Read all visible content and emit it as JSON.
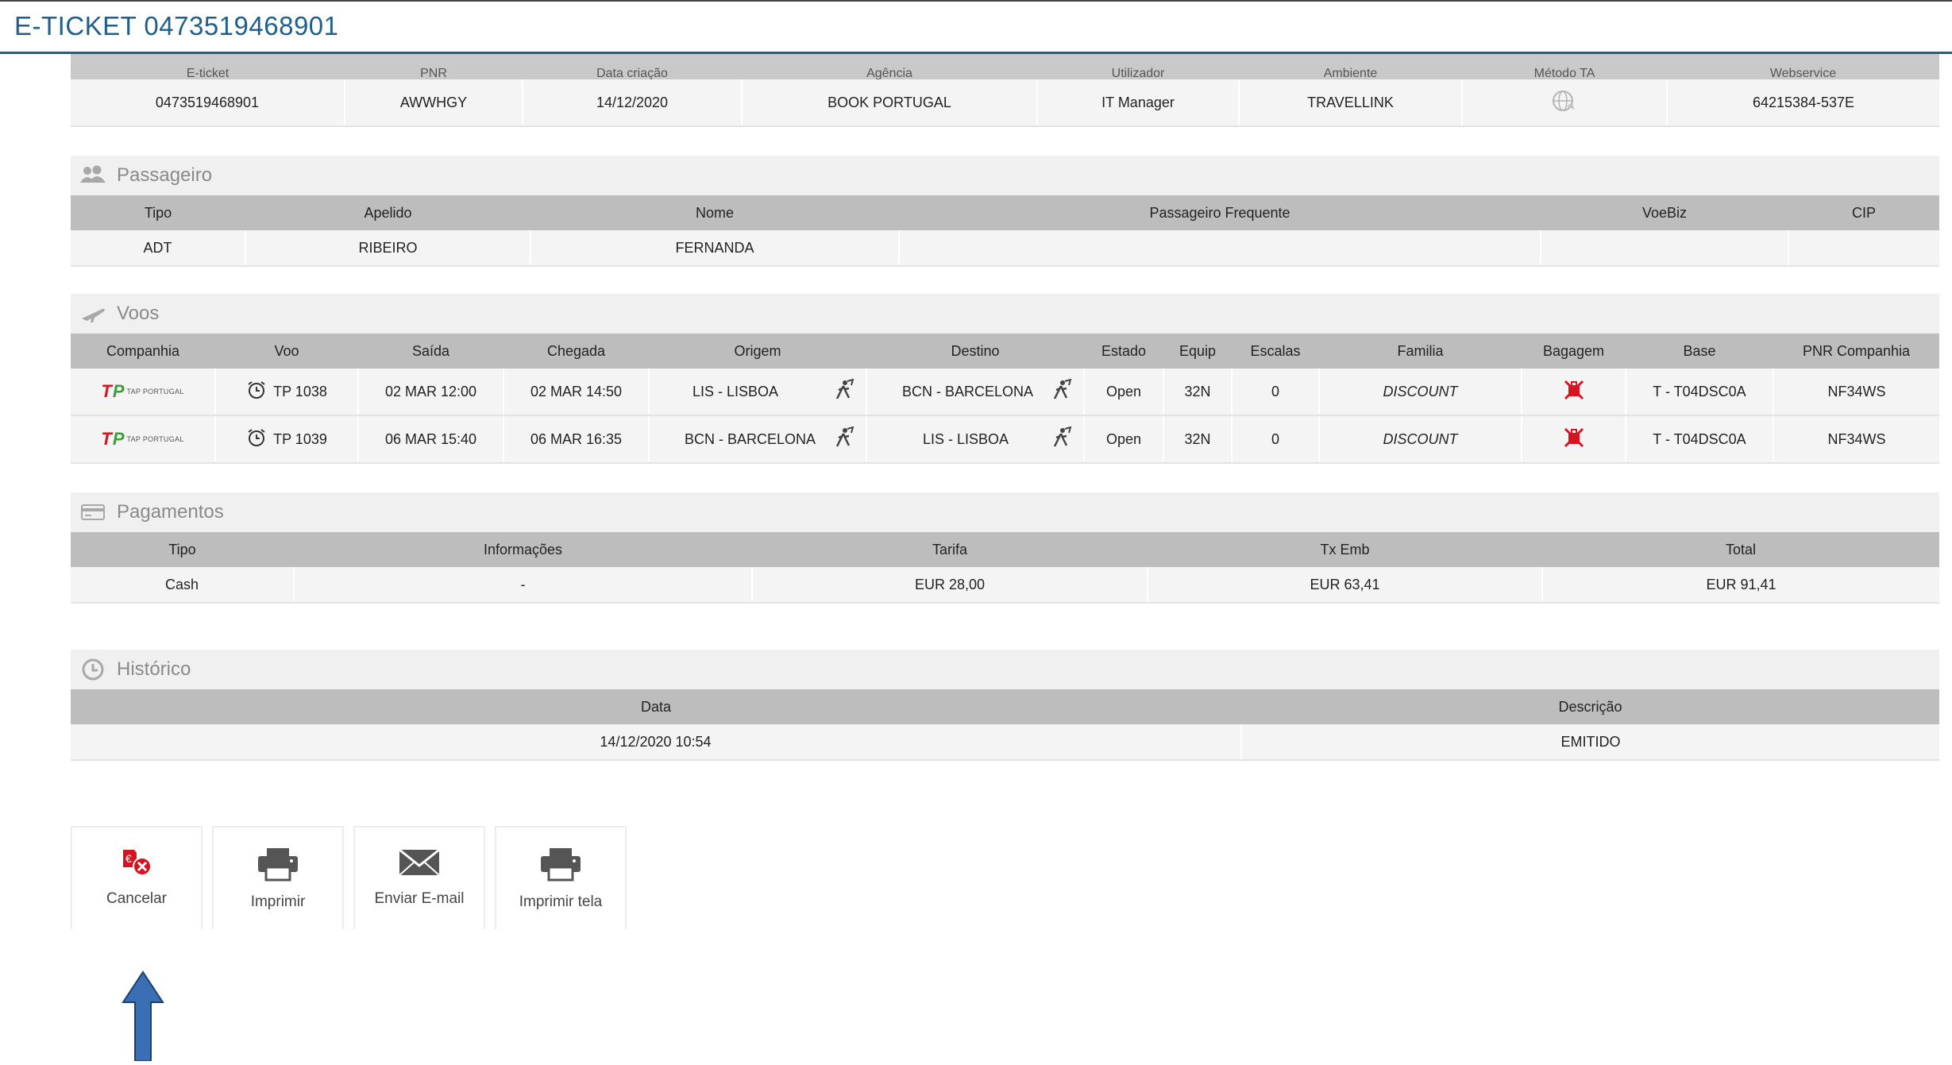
{
  "window": {
    "title": "E-TICKET 0473519468901"
  },
  "ticket": {
    "headers": [
      "E-ticket",
      "PNR",
      "Data criação",
      "Agência",
      "Utilizador",
      "Ambiente",
      "Método TA",
      "Webservice"
    ],
    "row": {
      "eticket": "0473519468901",
      "pnr": "AWWHGY",
      "date": "14/12/2020",
      "agency": "BOOK PORTUGAL",
      "user": "IT Manager",
      "env": "TRAVELLINK",
      "method_icon": "globe-icon",
      "webservice": "64215384-537E"
    }
  },
  "passengers": {
    "title": "Passageiro",
    "icon": "users-icon",
    "headers": [
      "Tipo",
      "Apelido",
      "Nome",
      "Passageiro Frequente",
      "VoeBiz",
      "CIP"
    ],
    "rows": [
      {
        "tipo": "ADT",
        "apelido": "RIBEIRO",
        "nome": "FERNANDA",
        "frequente": "",
        "voebiz": "",
        "cip": ""
      }
    ]
  },
  "flights": {
    "title": "Voos",
    "icon": "plane-icon",
    "headers": [
      "Companhia",
      "Voo",
      "Saída",
      "Chegada",
      "Origem",
      "Destino",
      "Estado",
      "Equip",
      "Escalas",
      "Familia",
      "Bagagem",
      "Base",
      "PNR Companhia"
    ],
    "airline_logo": {
      "mark_t": "T",
      "mark_p": "P",
      "text": "TAP PORTUGAL"
    },
    "rows": [
      {
        "voo": "TP 1038",
        "saida": "02 MAR 12:00",
        "chegada": "02 MAR 14:50",
        "origem": "LIS - LISBOA",
        "destino": "BCN - BARCELONA",
        "estado": "Open",
        "equip": "32N",
        "escalas": "0",
        "familia": "DISCOUNT",
        "base": "T - T04DSC0A",
        "pnr": "NF34WS"
      },
      {
        "voo": "TP 1039",
        "saida": "06 MAR 15:40",
        "chegada": "06 MAR 16:35",
        "origem": "BCN - BARCELONA",
        "destino": "LIS - LISBOA",
        "estado": "Open",
        "equip": "32N",
        "escalas": "0",
        "familia": "DISCOUNT",
        "base": "T - T04DSC0A",
        "pnr": "NF34WS"
      }
    ]
  },
  "payments": {
    "title": "Pagamentos",
    "icon": "credit-card-icon",
    "headers": [
      "Tipo",
      "Informações",
      "Tarifa",
      "Tx Emb",
      "Total"
    ],
    "rows": [
      {
        "tipo": "Cash",
        "info": "-",
        "tarifa": "EUR 28,00",
        "tx": "EUR 63,41",
        "total": "EUR 91,41"
      }
    ]
  },
  "history": {
    "title": "Histórico",
    "icon": "clock-icon",
    "headers": [
      "Data",
      "Descrição"
    ],
    "rows": [
      {
        "data": "14/12/2020 10:54",
        "desc": "EMITIDO"
      }
    ]
  },
  "actions": {
    "cancel": "Cancelar",
    "print": "Imprimir",
    "email": "Enviar E-mail",
    "print_screen": "Imprimir tela"
  },
  "colors": {
    "accent": "#1f5f8b",
    "header_gray": "#bdbdbd",
    "row_bg": "#f4f4f4",
    "arrow": "#3a6fb5",
    "danger": "#d7131f"
  }
}
